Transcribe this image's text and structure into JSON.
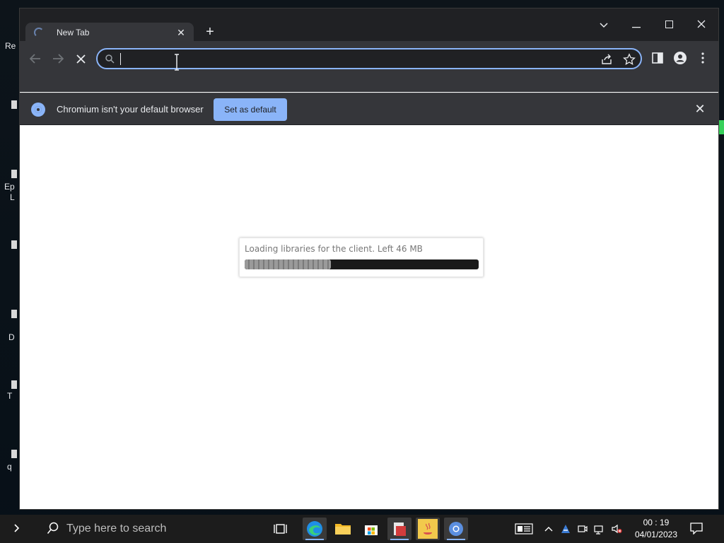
{
  "colors": {
    "accent": "#8ab4f8",
    "titlebar": "#202124",
    "toolbar": "#35363a",
    "taskbar": "#1c1c1c"
  },
  "desktop": {
    "labels": [
      "Re",
      "Ep",
      "L",
      "D",
      "T",
      "q"
    ]
  },
  "browser": {
    "tab": {
      "title": "New Tab",
      "close_icon": "close-icon"
    },
    "new_tab_icon": "plus-icon",
    "window_controls": [
      "chevron-down-icon",
      "minimize-icon",
      "maximize-icon",
      "close-icon"
    ],
    "omnibox": {
      "value": "",
      "placeholder": ""
    },
    "infobar": {
      "message": "Chromium isn't your default browser",
      "button": "Set as default"
    }
  },
  "loader": {
    "message": "Loading libraries for the client. Left 46 MB",
    "progress": 0.37
  },
  "taskbar": {
    "search_placeholder": "Type here to search",
    "apps": [
      "task-view-icon",
      "edge-icon",
      "file-explorer-icon",
      "store-icon",
      "app-icon",
      "java-icon",
      "chromium-icon"
    ],
    "time": "00 : 19",
    "date": "04/01/2023"
  }
}
